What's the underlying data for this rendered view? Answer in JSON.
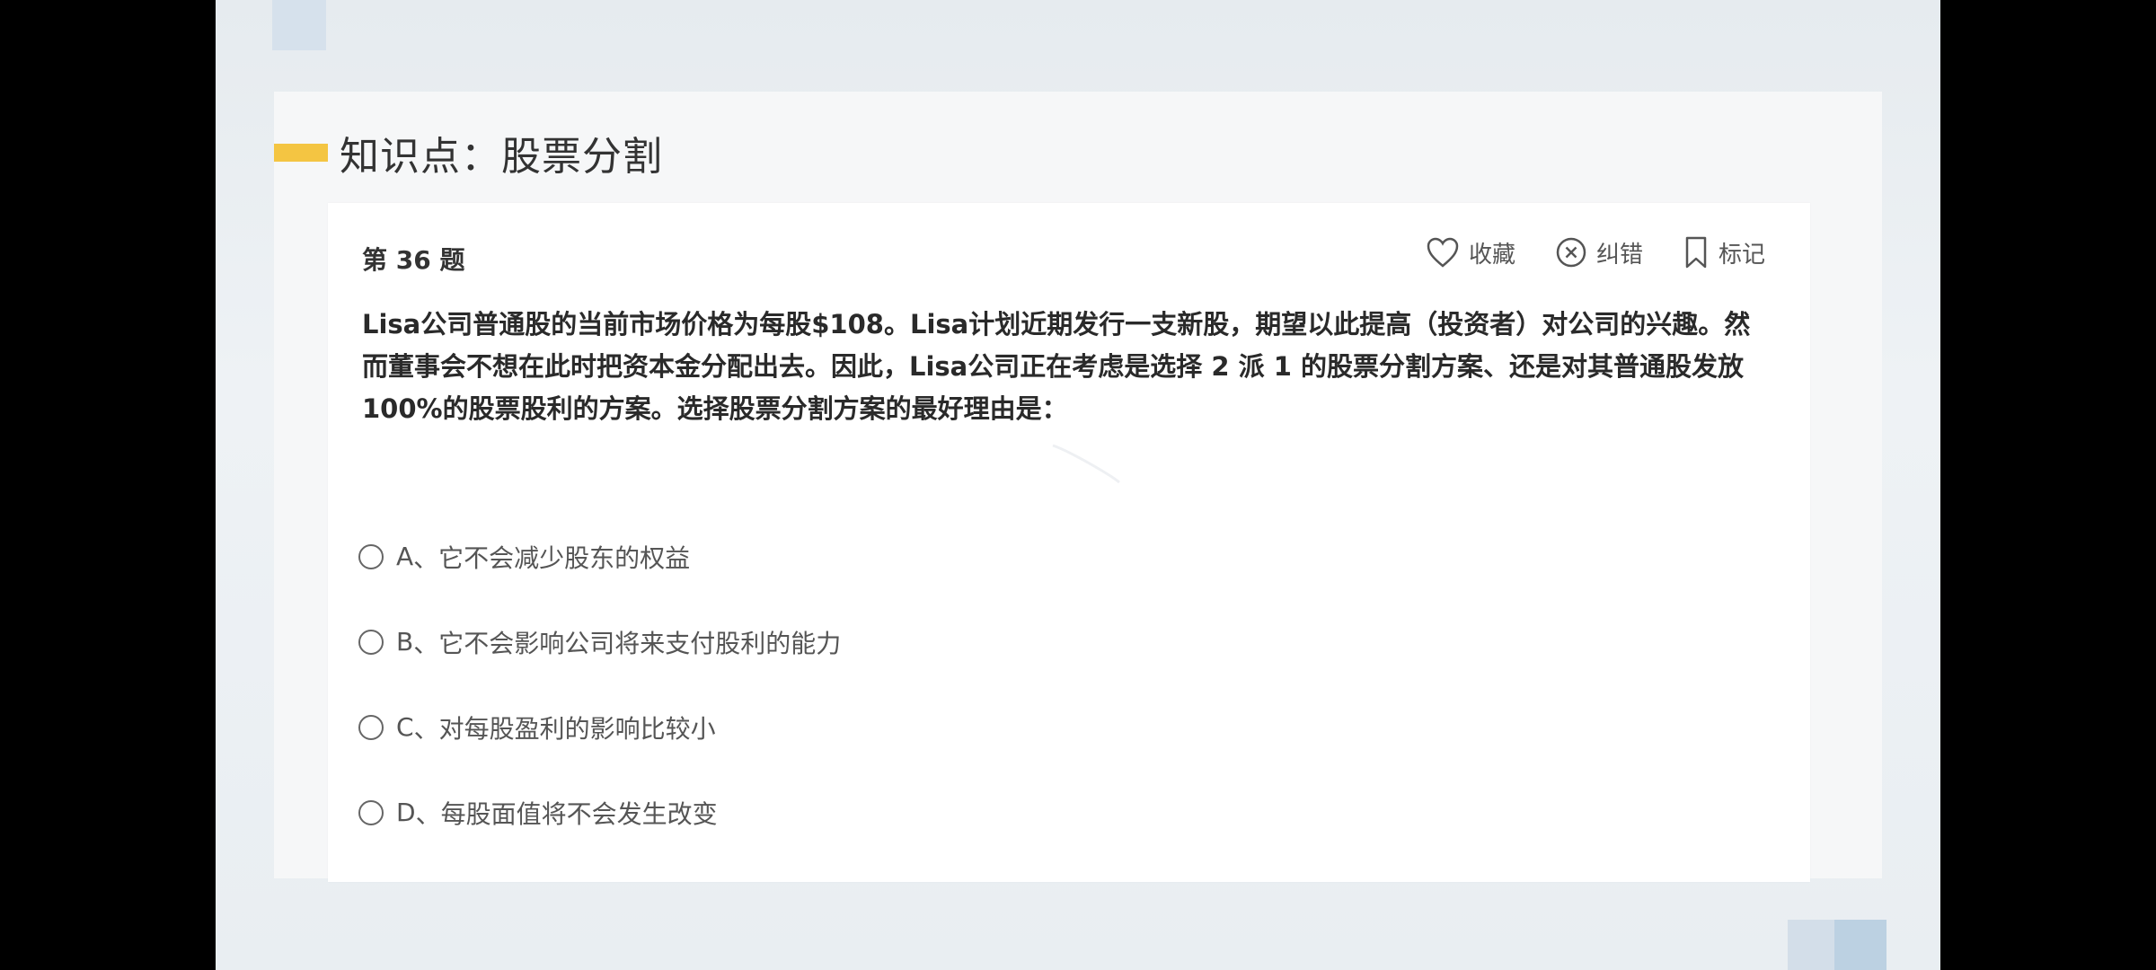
{
  "topic": {
    "title": "知识点：股票分割"
  },
  "question": {
    "number_label": "第 36 题",
    "text": "Lisa公司普通股的当前市场价格为每股$108。Lisa计划近期发行一支新股，期望以此提高（投资者）对公司的兴趣。然而董事会不想在此时把资本金分配出去。因此，Lisa公司正在考虑是选择 2 派 1 的股票分割方案、还是对其普通股发放 100%的股票股利的方案。选择股票分割方案的最好理由是："
  },
  "actions": {
    "favorite": {
      "label": "收藏",
      "icon": "heart-icon"
    },
    "report": {
      "label": "纠错",
      "icon": "close-circle-icon"
    },
    "mark": {
      "label": "标记",
      "icon": "bookmark-icon"
    }
  },
  "options": [
    {
      "letter": "A",
      "text": "它不会减少股东的权益"
    },
    {
      "letter": "B",
      "text": "它不会影响公司将来支付股利的能力"
    },
    {
      "letter": "C",
      "text": "对每股盈利的影响比较小"
    },
    {
      "letter": "D",
      "text": "每股面值将不会发生改变"
    }
  ],
  "colors": {
    "accent_bar": "#f4c542",
    "background": "#e9eef2",
    "card": "#ffffff",
    "letterbox": "#000000"
  }
}
